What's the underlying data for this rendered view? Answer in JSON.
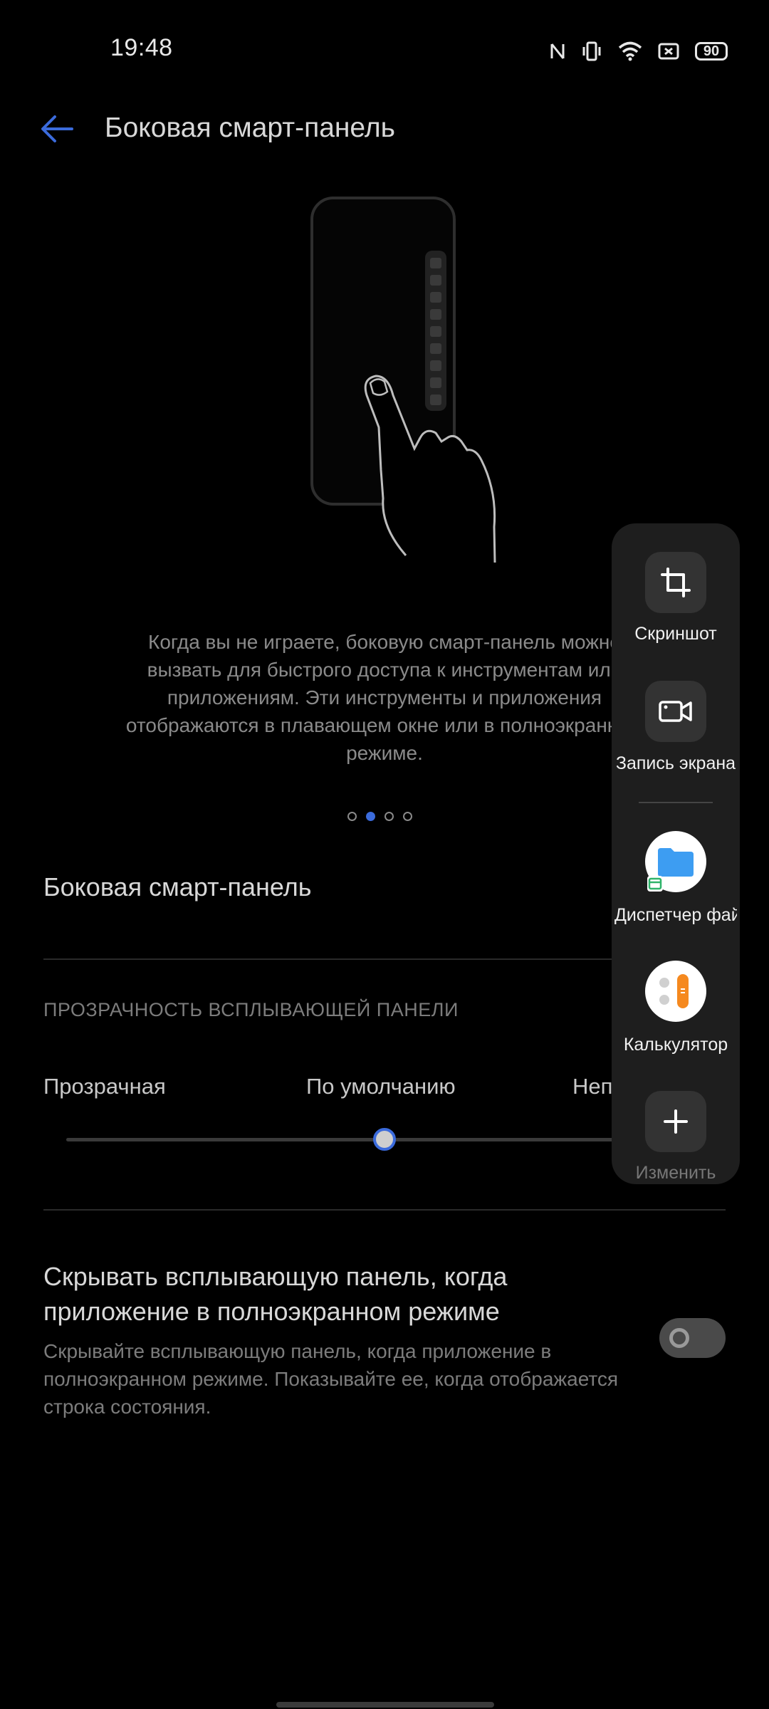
{
  "status_bar": {
    "time": "19:48",
    "battery": "90"
  },
  "header": {
    "title": "Боковая смарт-панель"
  },
  "intro": {
    "description": "Когда вы не играете, боковую смарт-панель можно вызвать для быстрого доступа к инструментам или приложениям. Эти инструменты и приложения отображаются в плавающем окне или в полноэкранном режиме.",
    "page_indicator": {
      "total": 4,
      "active": 2
    }
  },
  "settings": {
    "smart_panel_label": "Боковая смарт-панель",
    "transparency_header": "ПРОЗРАЧНОСТЬ ВСПЛЫВАЮЩЕЙ ПАНЕЛИ",
    "transparency_options": [
      "Прозрачная",
      "По умолчанию",
      "Непрозрачная"
    ],
    "transparency_value_fraction": 0.5,
    "hide_title": "Скрывать всплывающую панель, когда приложение в полноэкранном режиме",
    "hide_description": "Скрывайте всплывающую панель, когда приложение в полноэкранном режиме. Показывайте ее, когда отображается строка состояния.",
    "hide_toggle_on": false
  },
  "floating_panel": {
    "items": [
      {
        "label": "Скриншот",
        "icon": "crop-icon"
      },
      {
        "label": "Запись экрана",
        "icon": "video-camera-icon"
      },
      {
        "label": "Диспетчер файлов",
        "icon": "folder-icon"
      },
      {
        "label": "Калькулятор",
        "icon": "calculator-icon"
      },
      {
        "label": "Изменить",
        "icon": "plus-icon"
      }
    ]
  },
  "colors": {
    "accent": "#3b6bdc",
    "background": "#000000",
    "panel": "#1e1e1e"
  }
}
